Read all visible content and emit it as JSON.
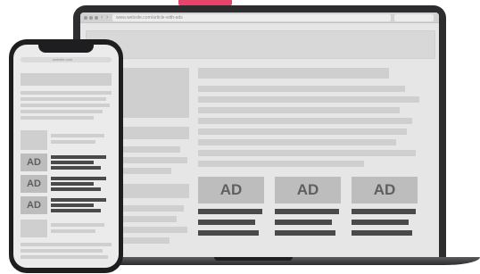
{
  "laptop": {
    "browser": {
      "url_text": "www.website.com/article-with-ads",
      "back_icon": "chevron-left-icon",
      "forward_icon": "chevron-right-icon"
    },
    "ads": [
      {
        "label": "AD"
      },
      {
        "label": "AD"
      },
      {
        "label": "AD"
      }
    ]
  },
  "phone": {
    "url_text": "website.com",
    "ads": [
      {
        "label": "AD"
      },
      {
        "label": "AD"
      },
      {
        "label": "AD"
      }
    ]
  },
  "colors": {
    "accent": "#e8436a",
    "device_frame": "#2d2d2f",
    "ad_fill": "#bdbdbd",
    "content_placeholder": "#cfcfcf"
  }
}
